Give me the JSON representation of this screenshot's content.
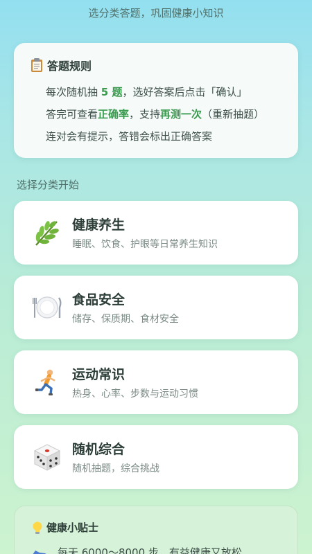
{
  "header": {
    "subtitle": "选分类答题，巩固健康小知识"
  },
  "rules": {
    "title": "答题规则",
    "line1": {
      "pre": "每次随机抽 ",
      "hl": "5 题",
      "post": "，选好答案后点击「确认」"
    },
    "line2": {
      "pre": "答完可查看",
      "hl1": "正确率",
      "mid": "，支持",
      "hl2": "再测一次",
      "post": "（重新抽题）"
    },
    "line3": "连对会有提示，答错会标出正确答案",
    "icon": "clipboard-icon"
  },
  "section_label": "选择分类开始",
  "categories": [
    {
      "title": "健康养生",
      "desc": "睡眠、饮食、护眼等日常养生知识",
      "icon": "herb-icon"
    },
    {
      "title": "食品安全",
      "desc": "储存、保质期、食材安全",
      "icon": "plate-cutlery-icon"
    },
    {
      "title": "运动常识",
      "desc": "热身、心率、步数与运动习惯",
      "icon": "runner-icon"
    },
    {
      "title": "随机综合",
      "desc": "随机抽题，综合挑战",
      "icon": "dice-icon"
    }
  ],
  "tips": {
    "title": "健康小贴士",
    "icon": "lightbulb-icon",
    "line": "每天 6000～8000 步，有益健康又放松",
    "line_icon": "shoe-icon"
  },
  "colors": {
    "accent_green": "#3a9a4e",
    "card_bg": "#ffffff",
    "tips_bg": "#d6f2d8"
  }
}
